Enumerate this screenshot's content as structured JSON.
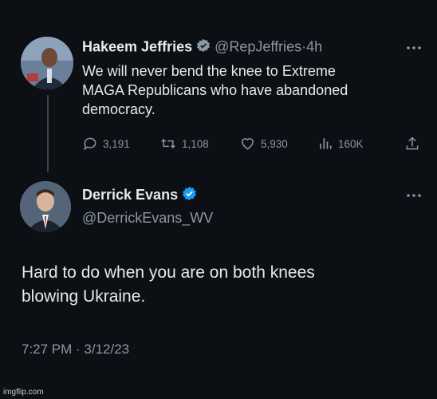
{
  "tweet1": {
    "author_name": "Hakeem Jeffries",
    "handle": "@RepJeffries",
    "dot": "·",
    "time": "4h",
    "text_lines": [
      "We will never bend the knee to Extreme",
      "MAGA Republicans who have abandoned",
      "democracy."
    ],
    "stats": {
      "replies": "3,191",
      "retweets": "1,108",
      "likes": "5,930",
      "views": "160K"
    }
  },
  "tweet2": {
    "author_name": "Derrick Evans",
    "handle": "@DerrickEvans_WV",
    "text_lines": [
      "Hard to do when you are on both knees",
      "blowing Ukraine."
    ],
    "timestamp": "7:27 PM · 3/12/23"
  },
  "watermark": "imgflip.com",
  "colors": {
    "background": "#0c0f14",
    "text": "#e7e9ea",
    "muted": "#8b98a5",
    "verified": "#1d9bf0"
  }
}
